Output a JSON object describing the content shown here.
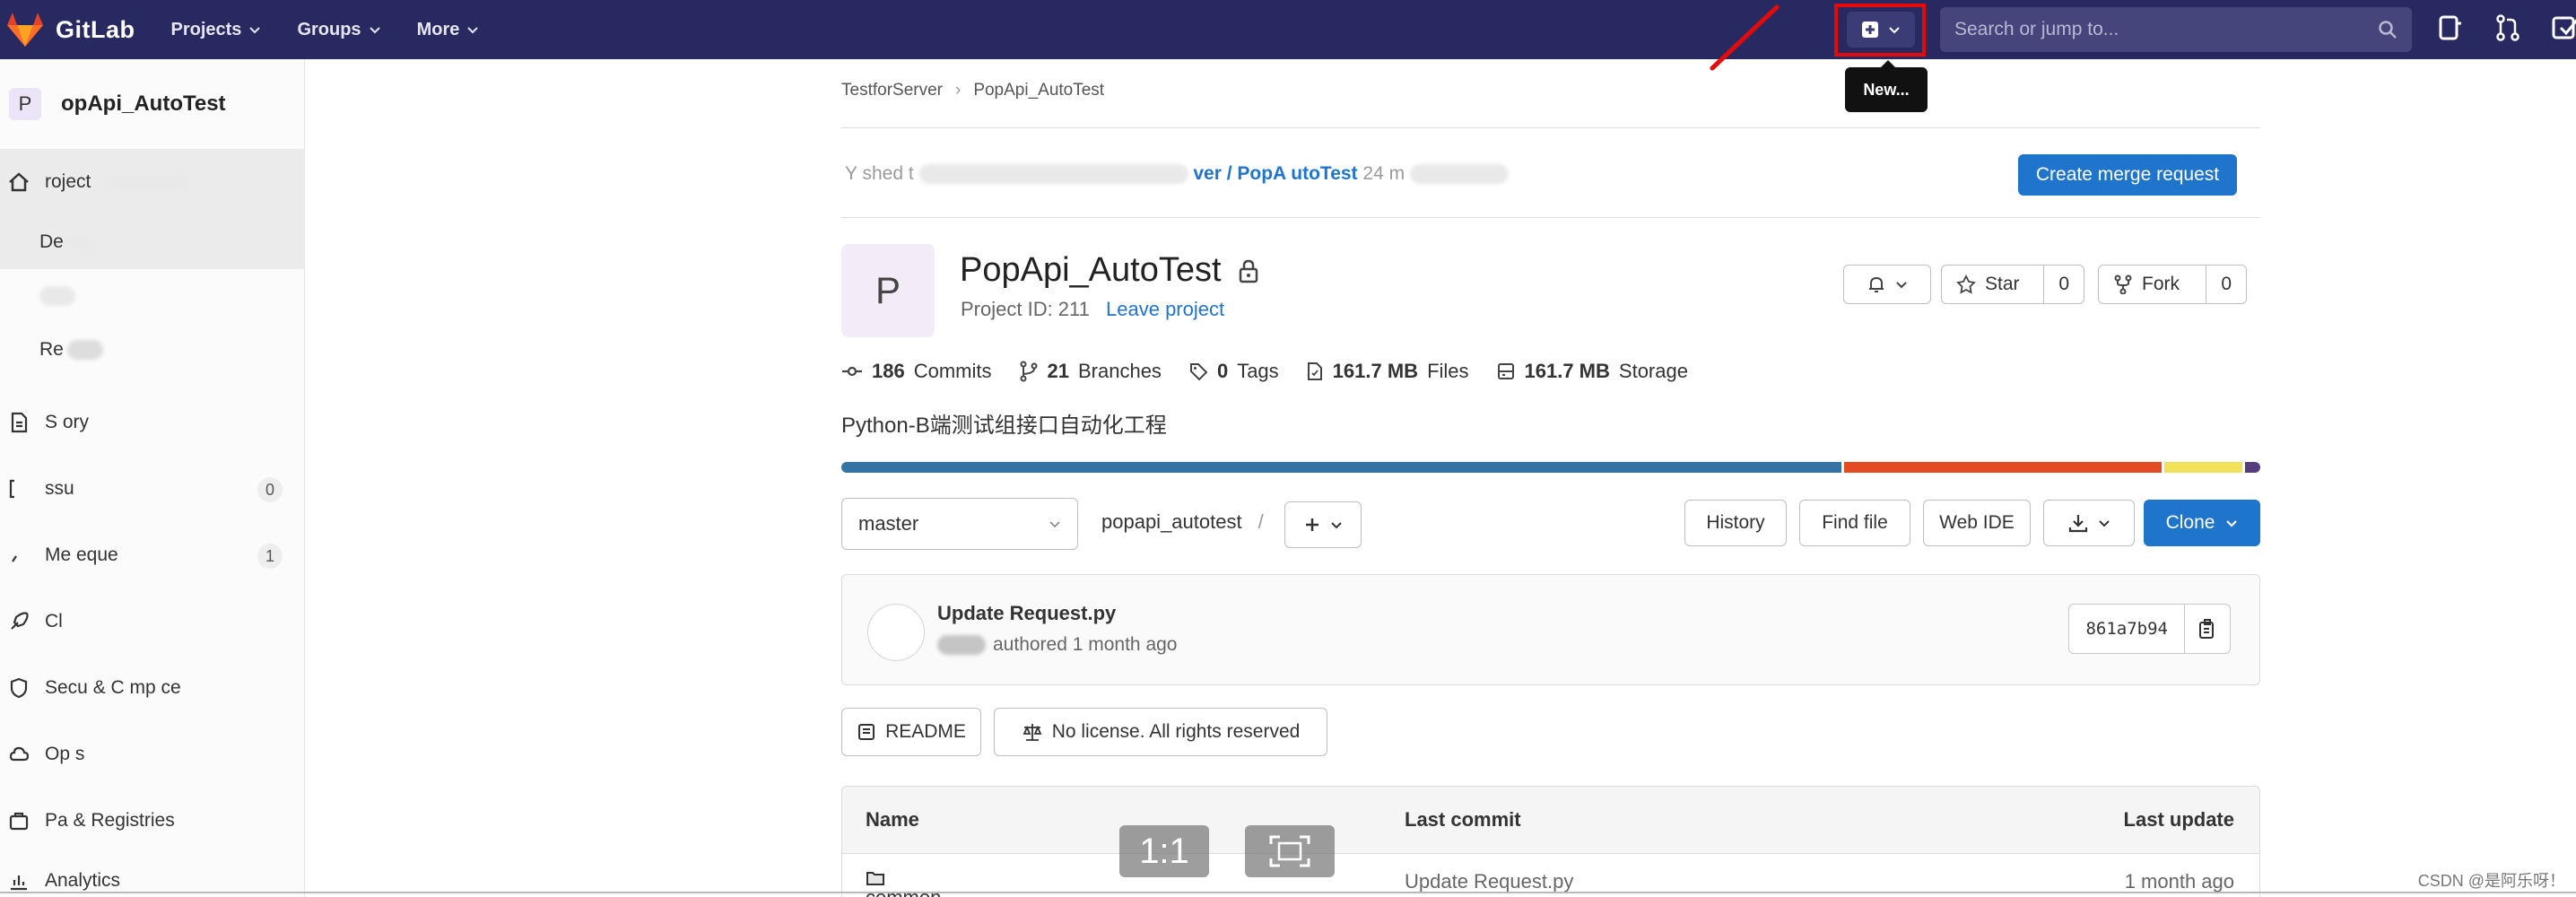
{
  "topbar": {
    "brand": "GitLab",
    "menu": [
      "Projects",
      "Groups",
      "More"
    ],
    "new_tooltip": "New...",
    "search_placeholder": "Search or jump to..."
  },
  "sidebar": {
    "avatar_letter": "P",
    "project_name": "opApi_AutoTest",
    "items": [
      {
        "label": "roject ",
        "icon": "home-icon"
      },
      {
        "label": "De",
        "sub": true
      },
      {
        "label": "",
        "sub": true
      },
      {
        "label": "Re",
        "sub": true
      },
      {
        "label": "S ory",
        "icon": "file-icon"
      },
      {
        "label": "ssu",
        "icon": "issues-icon",
        "count": "0"
      },
      {
        "label": "Me eque",
        "icon": "merge-request-icon",
        "count": "1"
      },
      {
        "label": "Cl",
        "icon": "rocket-icon"
      },
      {
        "label": "Secu & C mp ce",
        "icon": "shield-icon"
      },
      {
        "label": "Op s",
        "icon": "cloud-icon"
      },
      {
        "label": "Pa & Registries",
        "icon": "package-icon"
      },
      {
        "label": "Analytics",
        "icon": "chart-icon"
      }
    ]
  },
  "main": {
    "breadcrumb": [
      "TestforServer",
      "PopApi_AutoTest"
    ],
    "push_notice": {
      "prefix": "Y shed t",
      "link": "ver / PopA utoTest",
      "suffix": "24 m"
    },
    "create_mr_label": "Create merge request",
    "project": {
      "avatar_letter": "P",
      "title": "PopApi_AutoTest",
      "project_id": "Project ID: 211",
      "leave_label": "Leave project"
    },
    "star": {
      "label": "Star",
      "count": "0"
    },
    "fork": {
      "label": "Fork",
      "count": "0"
    },
    "stats": [
      {
        "value": "186",
        "label": "Commits",
        "icon": "commit-icon"
      },
      {
        "value": "21",
        "label": "Branches",
        "icon": "branch-icon"
      },
      {
        "value": "0",
        "label": "Tags",
        "icon": "tag-icon"
      },
      {
        "value": "161.7 MB",
        "label": "Files",
        "icon": "file-icon"
      },
      {
        "value": "161.7 MB",
        "label": "Storage",
        "icon": "storage-icon"
      }
    ],
    "description": "Python-B端测试组接口自动化工程",
    "language_bar": [
      {
        "share": 70.9,
        "color": "#3572a5"
      },
      {
        "share": 22.5,
        "color": "#e44b23"
      },
      {
        "share": 5.5,
        "color": "#f1e05a"
      },
      {
        "share": 1.1,
        "color": "#563d7c"
      }
    ],
    "branch": "master",
    "path": "popapi_autotest",
    "buttons": {
      "history": "History",
      "find_file": "Find file",
      "web_ide": "Web IDE",
      "clone": "Clone"
    },
    "last_commit": {
      "title": "Update Request.py",
      "authored": "authored 1 month ago",
      "sha": "861a7b94"
    },
    "readme_label": "README",
    "license_label": "No license. All rights reserved",
    "table": {
      "headers": [
        "Name",
        "Last commit",
        "Last update"
      ],
      "rows": [
        {
          "name": "common",
          "commit": "Update Request.py",
          "updated": "1 month ago"
        }
      ]
    }
  },
  "overlay": {
    "zoom_label": "1:1"
  },
  "watermark": "CSDN @是阿乐呀！"
}
